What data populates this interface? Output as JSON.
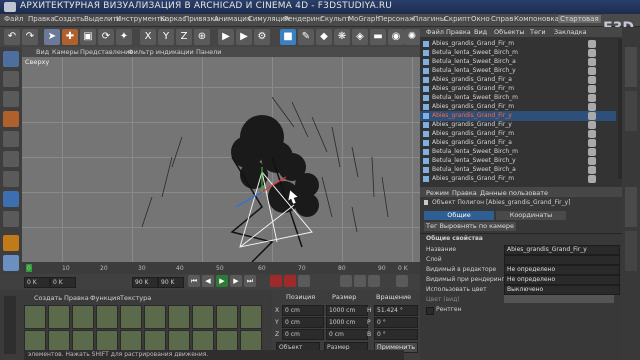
{
  "window": {
    "title": "АРХИТЕКТУРНАЯ ВИЗУАЛИЗАЦИЯ В ARCHICAD И CINEMA 4D - F3DSTUDIYA.RU",
    "brand": "F3D"
  },
  "menu": [
    "Файл",
    "Правка",
    "Создать",
    "Выделить",
    "Инструменты",
    "Каркас",
    "Привязка",
    "Анимация",
    "Симуляция",
    "Рендеринг",
    "Скульпт",
    "MoGraph",
    "Персонаж",
    "Плагины",
    "Скрипт",
    "Окно",
    "Справ",
    "Компоновка",
    "Стартовая"
  ],
  "viewport_menu": [
    "Вид",
    "Камеры",
    "Представление",
    "Фильтр индикации",
    "Панели"
  ],
  "viewport": {
    "label": "Сверху"
  },
  "object_manager": {
    "menu": [
      "Файл",
      "Правка",
      "Вид",
      "Объекты",
      "Теги",
      "Закладка"
    ],
    "items": [
      {
        "name": "Abies_grandis_Grand_Fir_m",
        "selected": false
      },
      {
        "name": "Betula_lenta_Sweet_Birch_m",
        "selected": false
      },
      {
        "name": "Betula_lenta_Sweet_Birch_a",
        "selected": false
      },
      {
        "name": "Betula_lenta_Sweet_Birch_y",
        "selected": false
      },
      {
        "name": "Abies_grandis_Grand_Fir_a",
        "selected": false
      },
      {
        "name": "Abies_grandis_Grand_Fir_m",
        "selected": false
      },
      {
        "name": "Betula_lenta_Sweet_Birch_m",
        "selected": false
      },
      {
        "name": "Abies_grandis_Grand_Fir_m",
        "selected": false
      },
      {
        "name": "Abies_grandis_Grand_Fir_y",
        "selected": true
      },
      {
        "name": "Abies_grandis_Grand_Fir_y",
        "selected": false
      },
      {
        "name": "Abies_grandis_Grand_Fir_m",
        "selected": false
      },
      {
        "name": "Abies_grandis_Grand_Fir_a",
        "selected": false
      },
      {
        "name": "Betula_lenta_Sweet_Birch_m",
        "selected": false
      },
      {
        "name": "Betula_lenta_Sweet_Birch_y",
        "selected": false
      },
      {
        "name": "Betula_lenta_Sweet_Birch_a",
        "selected": false
      },
      {
        "name": "Abies_grandis_Grand_Fir_m",
        "selected": false
      }
    ]
  },
  "attributes": {
    "menu": [
      "Режим",
      "Правка",
      "Данные пользовате"
    ],
    "object_line": "Объект Полигон [Abies_grandis_Grand_Fir_y]",
    "tabs": {
      "basic": "Общие",
      "coords": "Координаты",
      "tag": "Тег Выровнять по камере"
    },
    "section": "Общие свойства",
    "props": [
      {
        "label": "Название",
        "value": "Abies_grandis_Grand_Fir_y"
      },
      {
        "label": "Слой",
        "value": ""
      },
      {
        "label": "Видимый в редакторе",
        "value": "Не определено"
      },
      {
        "label": "Видимый при рендеринге",
        "value": "Не определено"
      },
      {
        "label": "Использовать цвет",
        "value": "Выключено"
      },
      {
        "label": "Цвет (вид)",
        "value": ""
      },
      {
        "label": "Рентген",
        "value": ""
      }
    ]
  },
  "timeline": {
    "ticks": [
      "0",
      "10",
      "20",
      "30",
      "40",
      "50",
      "60",
      "70",
      "80",
      "90"
    ],
    "end": "0 K"
  },
  "playback": {
    "start": "0 K",
    "current": "0 K",
    "end": "90 K",
    "end2": "90 K"
  },
  "material_manager": {
    "menu": [
      "Создать",
      "Правка",
      "Функция",
      "Текстура"
    ],
    "tile_count_row1": 10,
    "tile_count_row2": 10
  },
  "coord_manager": {
    "headers": [
      "Позиция",
      "Размер",
      "Вращение"
    ],
    "rows": [
      {
        "axis": "X",
        "pos": "0 cm",
        "size": "1000 cm",
        "rot_axis": "H",
        "rot": "51.424 °"
      },
      {
        "axis": "Y",
        "pos": "0 cm",
        "size": "1000 cm",
        "rot_axis": "P",
        "rot": "0 °"
      },
      {
        "axis": "Z",
        "pos": "0 cm",
        "size": "0 cm",
        "rot_axis": "B",
        "rot": "0 °"
      }
    ],
    "mode1": "Объект",
    "mode2": "Размер",
    "apply": "Применить"
  },
  "status": "элементов. Нажать SHIFT для растрирования движения."
}
